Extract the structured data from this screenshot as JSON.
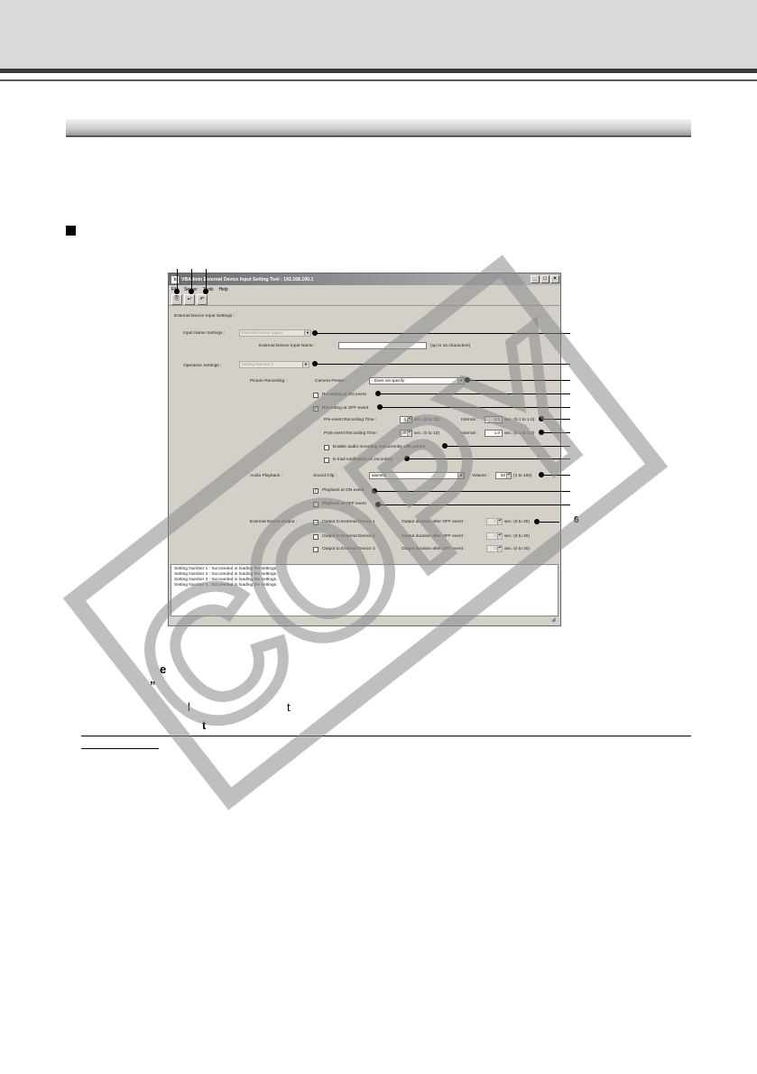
{
  "window": {
    "icon": "b",
    "title": "VBAdmin External Device Input Setting Tool - 192.168.100.1",
    "minimize": "_",
    "maximize": "□",
    "close": "×"
  },
  "menu": [
    "File",
    "Server",
    "Tools",
    "Help"
  ],
  "toolbar": {
    "buttons": [
      {
        "icon": "open-icon",
        "glyph": "⎘"
      },
      {
        "icon": "save-icon",
        "glyph": "↵"
      },
      {
        "icon": "undo-icon",
        "glyph": "↶"
      }
    ]
  },
  "settings": {
    "group_label": "External Device Input Settings :",
    "input_name_label": "Input Name Settings :",
    "input_name_combo": "External Device Input1",
    "device_input_name_label": "External Device Input Name :",
    "device_input_name_value": "",
    "device_input_name_hint": "(up to 15 characters)",
    "operation_label": "Operation Settings :",
    "operation_combo": "Setting Number 1",
    "picture_recording_label": "Picture Recording :",
    "camera_preset_label": "Camera Preset :",
    "camera_preset_value": "- Does not specify -",
    "recording_on_event": "Recording at ON event",
    "recording_off_event": "Recording at OFF event",
    "recording_off_checked": "✓",
    "pre_event_label": "Pre-event Recording Time :",
    "pre_event_value": "0",
    "pre_event_range": "sec. (0 to 10)",
    "pre_interval_label": "Interval :",
    "pre_interval_value": "1.0",
    "pre_interval_range": "sec. (0.1 to 1.0)",
    "post_event_label": "Post-event Recording Time :",
    "post_event_value": "0",
    "post_event_range": "sec. (0 to 10)",
    "post_interval_label": "Interval :",
    "post_interval_value": "1.0",
    "post_interval_range": "sec. (0.1 to 1.0)",
    "enable_audio": "Enable audio recording concurrently with picture",
    "email_notification": "E-mail notification on recording",
    "audio_playback_label": "Audio Playback :",
    "sound_clip_label": "Sound Clip :",
    "sound_clip_value": "alarm01",
    "volume_label": "Volume :",
    "volume_value": "50",
    "volume_range": "(1 to 100)",
    "playback_on_event": "Playback at ON event",
    "playback_on_checked": "✓",
    "playback_off_event": "Playback at OFF event",
    "external_output_label": "External Device Output :",
    "outputs": [
      {
        "label": "Output to External Device 1",
        "duration_label": "Output duration after OFF event :",
        "value": "0",
        "range": "sec. (0 to 30)"
      },
      {
        "label": "Output to External Device 2",
        "duration_label": "Output duration after OFF event :",
        "value": "0",
        "range": "sec. (0 to 30)"
      },
      {
        "label": "Output to External Device 3",
        "duration_label": "Output duration after OFF event :",
        "value": "0",
        "range": "sec. (0 to 30)"
      }
    ]
  },
  "status": [
    "Setting Number 1 : Succeeded in loading the settings.",
    "Setting Number 2 : Succeeded in loading the settings.",
    "Setting Number 3 : Succeeded in loading the settings.",
    "Setting Number 4 : Succeeded in loading the settings."
  ],
  "callout_six": "6",
  "fragments": [
    "e",
    "”",
    "l",
    "t",
    "t"
  ],
  "watermark": "COPY"
}
